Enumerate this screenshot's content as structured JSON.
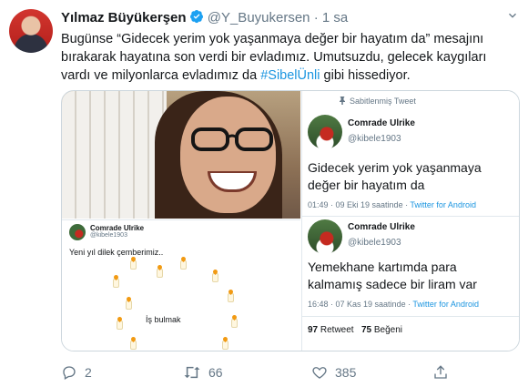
{
  "author": {
    "name": "Yılmaz Büyükerşen",
    "handle": "@Y_Buyukersen",
    "separator": "·",
    "time": "1 sa"
  },
  "tweet": {
    "line1": "Bugünse “Gidecek yerim yok yaşanmaya değer bir hayatım da” mesajını",
    "line2": "bırakarak hayatına son verdi bir evladımız. Umutsuzdu, gelecek kaygıları",
    "line3_pre": "vardı ve milyonlarca evladımız da ",
    "hashtag": "#SibelÜnli",
    "line3_post": " gibi hissediyor."
  },
  "screenshot_left": {
    "name": "Comrade Ulrike",
    "handle": "@kibele1903",
    "text": "Yeni yıl dilek çemberimiz..",
    "center_text": "İş bulmak"
  },
  "screenshot_right": {
    "pinned_label": "Sabitlenmiş Tweet",
    "t1": {
      "name": "Comrade Ulrike",
      "handle": "@kibele1903",
      "line1": "Gidecek yerim yok yaşanmaya",
      "line2": "değer bir hayatım da",
      "meta": "01:49 · 09 Eki 19 saatinde · ",
      "source": "Twitter for Android"
    },
    "t2": {
      "name": "Comrade Ulrike",
      "handle": "@kibele1903",
      "line1": "Yemekhane kartımda para",
      "line2": "kalmamış sadece bir liram var",
      "meta": "16:48 · 07 Kas 19 saatinde · ",
      "source": "Twitter for Android"
    },
    "retweets": "97",
    "retweets_label": " Retweet",
    "likes": "75",
    "likes_label": " Beğeni"
  },
  "actions": {
    "replies": "2",
    "retweets": "66",
    "likes": "385"
  },
  "colors": {
    "accent": "#1b95e0",
    "muted": "#657786",
    "text": "#14171a"
  }
}
